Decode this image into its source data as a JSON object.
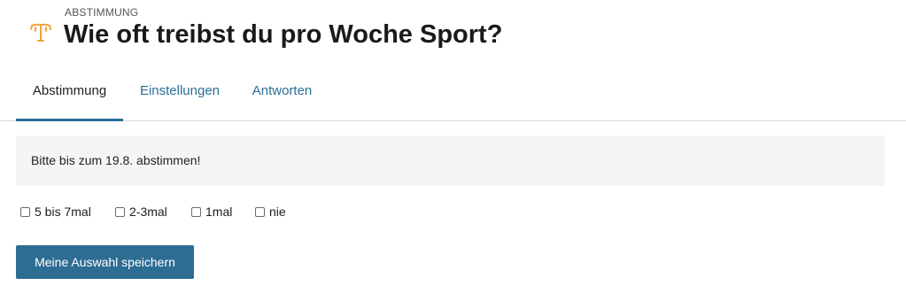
{
  "header": {
    "kicker": "ABSTIMMUNG",
    "title": "Wie oft treibst du pro Woche Sport?",
    "icon": "poll-icon",
    "icon_color": "#f0a33b"
  },
  "tabs": [
    {
      "label": "Abstimmung",
      "active": true
    },
    {
      "label": "Einstellungen",
      "active": false
    },
    {
      "label": "Antworten",
      "active": false
    }
  ],
  "notice": {
    "text": "Bitte bis zum 19.8. abstimmen!"
  },
  "options": [
    {
      "label": "5 bis 7mal",
      "checked": false
    },
    {
      "label": "2-3mal",
      "checked": false
    },
    {
      "label": "1mal",
      "checked": false
    },
    {
      "label": "nie",
      "checked": false
    }
  ],
  "save_button": {
    "label": "Meine Auswahl speichern",
    "color": "#2e6d93"
  },
  "colors": {
    "accent": "#2a6f97",
    "notice_bg": "#f4f5f6"
  }
}
